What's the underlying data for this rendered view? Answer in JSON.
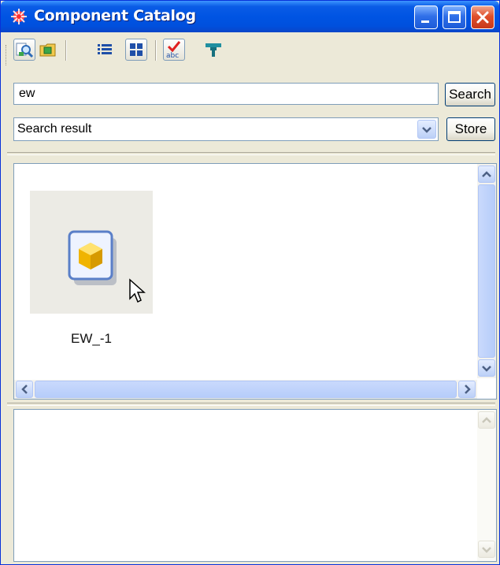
{
  "window": {
    "title": "Component Catalog"
  },
  "toolbar": {
    "tools": [
      {
        "icon": "find-icon"
      },
      {
        "icon": "folder-icon"
      },
      {
        "icon": "list-view-icon"
      },
      {
        "icon": "icon-view-icon"
      },
      {
        "icon": "spell-check-icon"
      },
      {
        "icon": "filter-icon"
      }
    ]
  },
  "search": {
    "value": "ew",
    "button_label": "Search"
  },
  "result_selector": {
    "value": "Search result",
    "store_label": "Store"
  },
  "results": {
    "items": [
      {
        "label": "EW_-1",
        "icon": "component-part-icon"
      }
    ]
  },
  "colors": {
    "title_bar": "#0054e3",
    "window_bg": "#ece9d8",
    "close_button": "#e0502c"
  }
}
